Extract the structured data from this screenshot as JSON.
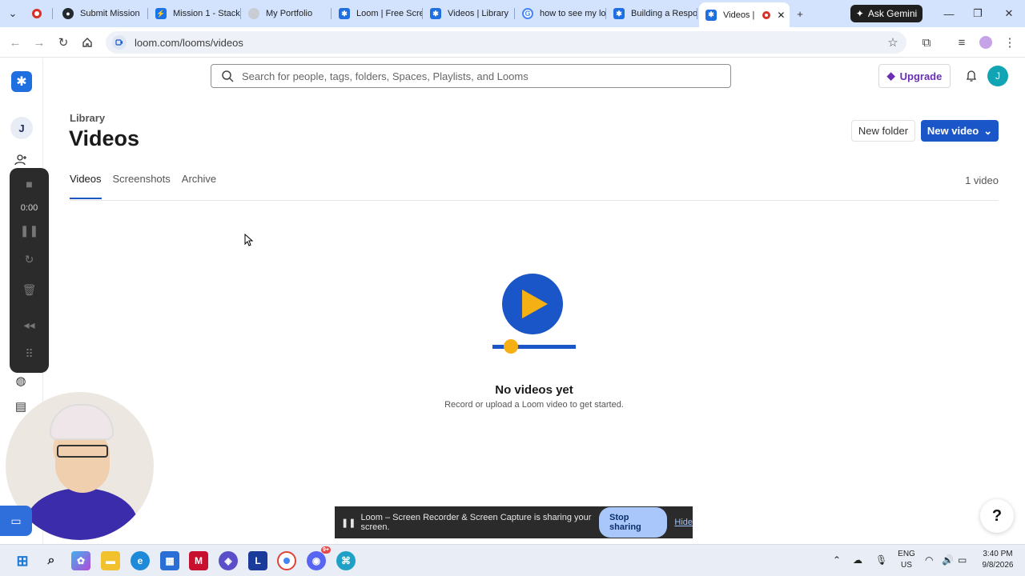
{
  "browser": {
    "tabs": [
      {
        "label": "",
        "icon": "recording-dot-icon",
        "color": "#d93025"
      },
      {
        "label": "Submit Mission",
        "icon": "github-icon",
        "color": "#24292f"
      },
      {
        "label": "Mission 1 - Stack",
        "icon": "lightning-icon",
        "color": "#1a73e8"
      },
      {
        "label": "My Portfolio",
        "icon": "globe-icon",
        "color": "#9aa0a6"
      },
      {
        "label": "Loom | Free Scre",
        "icon": "loom-icon",
        "color": "#1f6fe0"
      },
      {
        "label": "Videos | Library",
        "icon": "loom-icon",
        "color": "#1f6fe0"
      },
      {
        "label": "how to see my lo",
        "icon": "google-icon",
        "color": "#4285f4"
      },
      {
        "label": "Building a Respo",
        "icon": "loom-icon",
        "color": "#1f6fe0"
      },
      {
        "label": "Videos |",
        "icon": "loom-icon",
        "color": "#1f6fe0"
      }
    ],
    "gemini_label": "Ask Gemini",
    "url": "loom.com/looms/videos"
  },
  "app": {
    "rail_avatar_initial": "J",
    "recorder_time": "0:00",
    "search_placeholder": "Search for people, tags, folders, Spaces, Playlists, and Looms",
    "upgrade_label": "Upgrade",
    "avatar_initial": "J",
    "breadcrumb": "Library",
    "title": "Videos",
    "new_folder_label": "New folder",
    "new_video_label": "New video",
    "tabs": [
      {
        "label": "Videos",
        "active": true
      },
      {
        "label": "Screenshots",
        "active": false
      },
      {
        "label": "Archive",
        "active": false
      }
    ],
    "video_count": "1 video",
    "empty_title": "No videos yet",
    "empty_subtitle": "Record or upload a Loom video to get started.",
    "help_label": "?",
    "accent": "#1a56c8"
  },
  "sharebar": {
    "message": "Loom – Screen Recorder & Screen Capture is sharing your screen.",
    "stop_label": "Stop sharing",
    "hide_label": "Hide"
  },
  "taskbar": {
    "lang_top": "ENG",
    "lang_bottom": "US",
    "time": "3:40 PM",
    "date": "9/8/2026",
    "discord_badge": "9+"
  }
}
